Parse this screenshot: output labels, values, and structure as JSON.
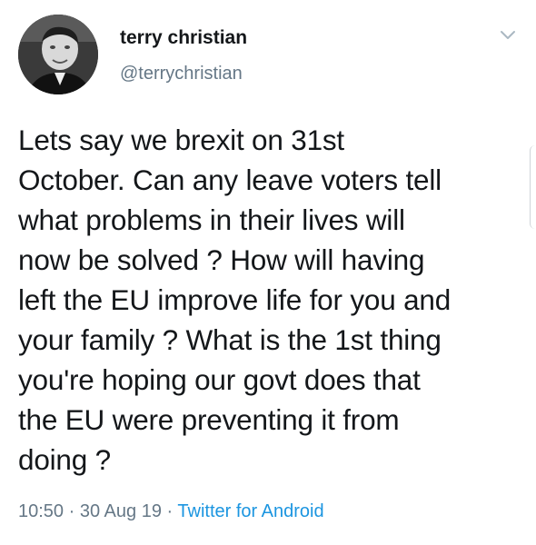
{
  "author": {
    "display_name": "terry christian",
    "handle": "@terrychristian",
    "avatar_icon": "profile-photo"
  },
  "menu": {
    "icon": "chevron-down-icon"
  },
  "tweet": {
    "text": "Lets say we brexit on 31st\nOctober. Can any leave voters tell\nwhat problems in their lives will\nnow be solved ? How will having\nleft the EU improve life for you and\nyour family ? What is the 1st thing\nyou're hoping our govt does that\nthe EU were preventing it from\ndoing ?"
  },
  "meta": {
    "time": "10:50",
    "separator": "·",
    "date": "30 Aug 19",
    "source": "Twitter for Android"
  },
  "colors": {
    "text": "#14171a",
    "secondary": "#657786",
    "link": "#1b95e0"
  }
}
